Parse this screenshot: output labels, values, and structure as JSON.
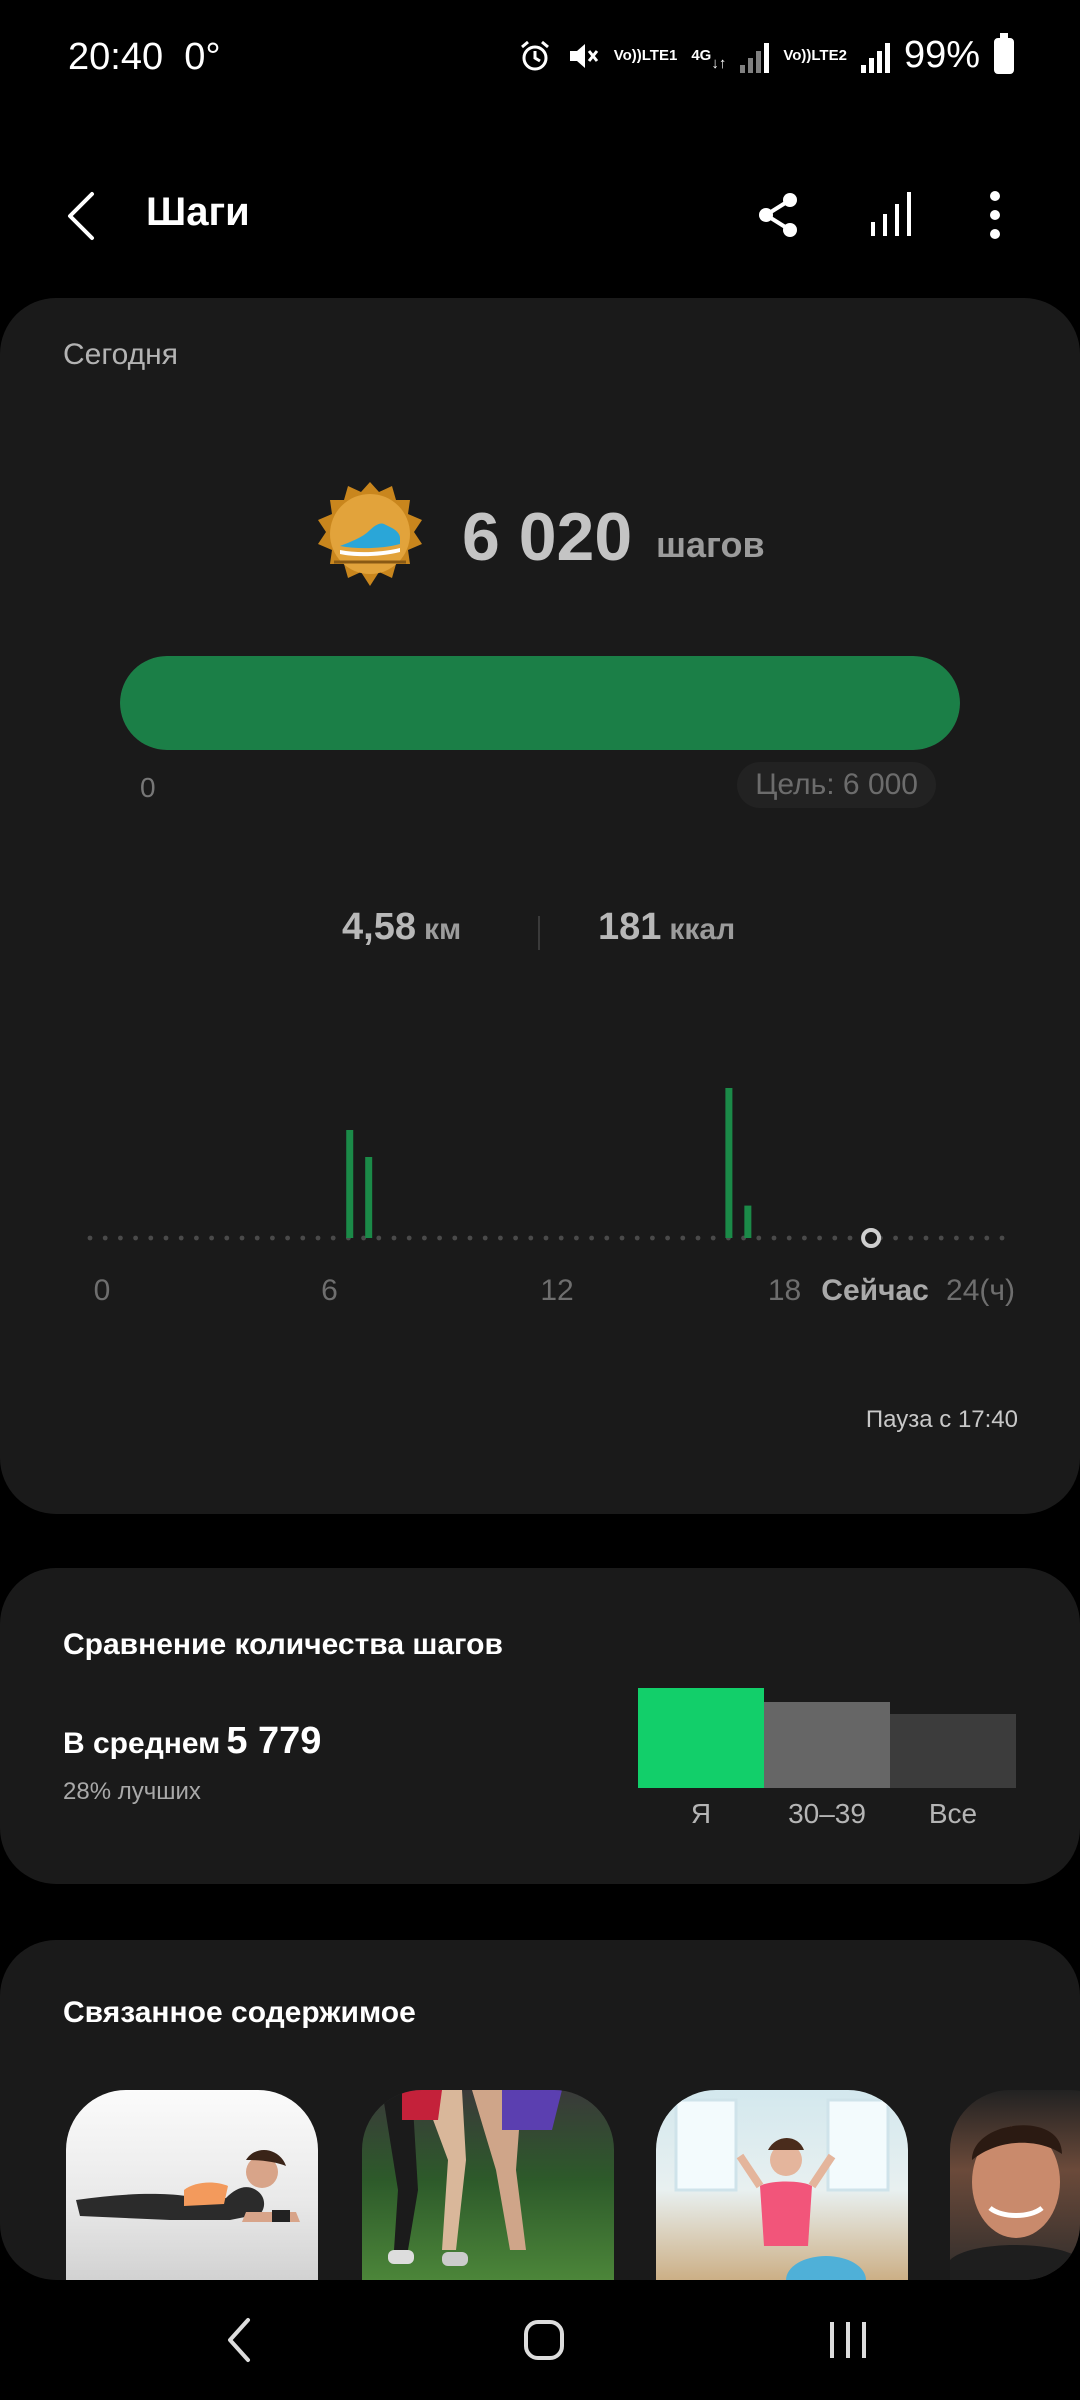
{
  "status_bar": {
    "time": "20:40",
    "temperature": "0°",
    "sim1": "LTE1",
    "sim2": "LTE2",
    "network": "4G",
    "battery": "99%"
  },
  "appbar": {
    "title": "Шаги",
    "icons": [
      "back-arrow-icon",
      "share-icon",
      "bar-chart-icon",
      "more-vert-icon"
    ]
  },
  "today": {
    "label": "Сегодня",
    "steps": "6 020",
    "steps_unit": "шагов",
    "progress_fraction": 1.0,
    "progress_min": "0",
    "goal": "Цель: 6 000",
    "distance": "4,58",
    "distance_unit": "км",
    "calories": "181",
    "calories_unit": "ккал",
    "pause_text": "Пауза с 17:40",
    "accent": "#1b7f47"
  },
  "chart_data": {
    "type": "bar",
    "x_ticks": [
      "0",
      "6",
      "12",
      "18",
      "24(ч)"
    ],
    "now_label": "Сейчас",
    "xlim": [
      0,
      24
    ],
    "bars_hour": [
      6.85,
      7.35,
      16.85,
      17.35
    ],
    "bars_rel_height": [
      0.6,
      0.45,
      1.0,
      0.18
    ],
    "now_hour": 20.6,
    "color": "#1b8a48"
  },
  "compare": {
    "title": "Сравнение количества шагов",
    "avg_label": "В среднем",
    "avg_value": "5 779",
    "percent_text": "28% лучших",
    "bars": [
      {
        "label": "Я",
        "color": "#12cf6a"
      },
      {
        "label": "30–39",
        "color": "#666666"
      },
      {
        "label": "Все",
        "color": "#3c3c3c"
      }
    ]
  },
  "related": {
    "title": "Связанное содержимое"
  },
  "navbar": {
    "icons": [
      "nav-back-icon",
      "home-icon",
      "recent-apps-icon"
    ]
  }
}
